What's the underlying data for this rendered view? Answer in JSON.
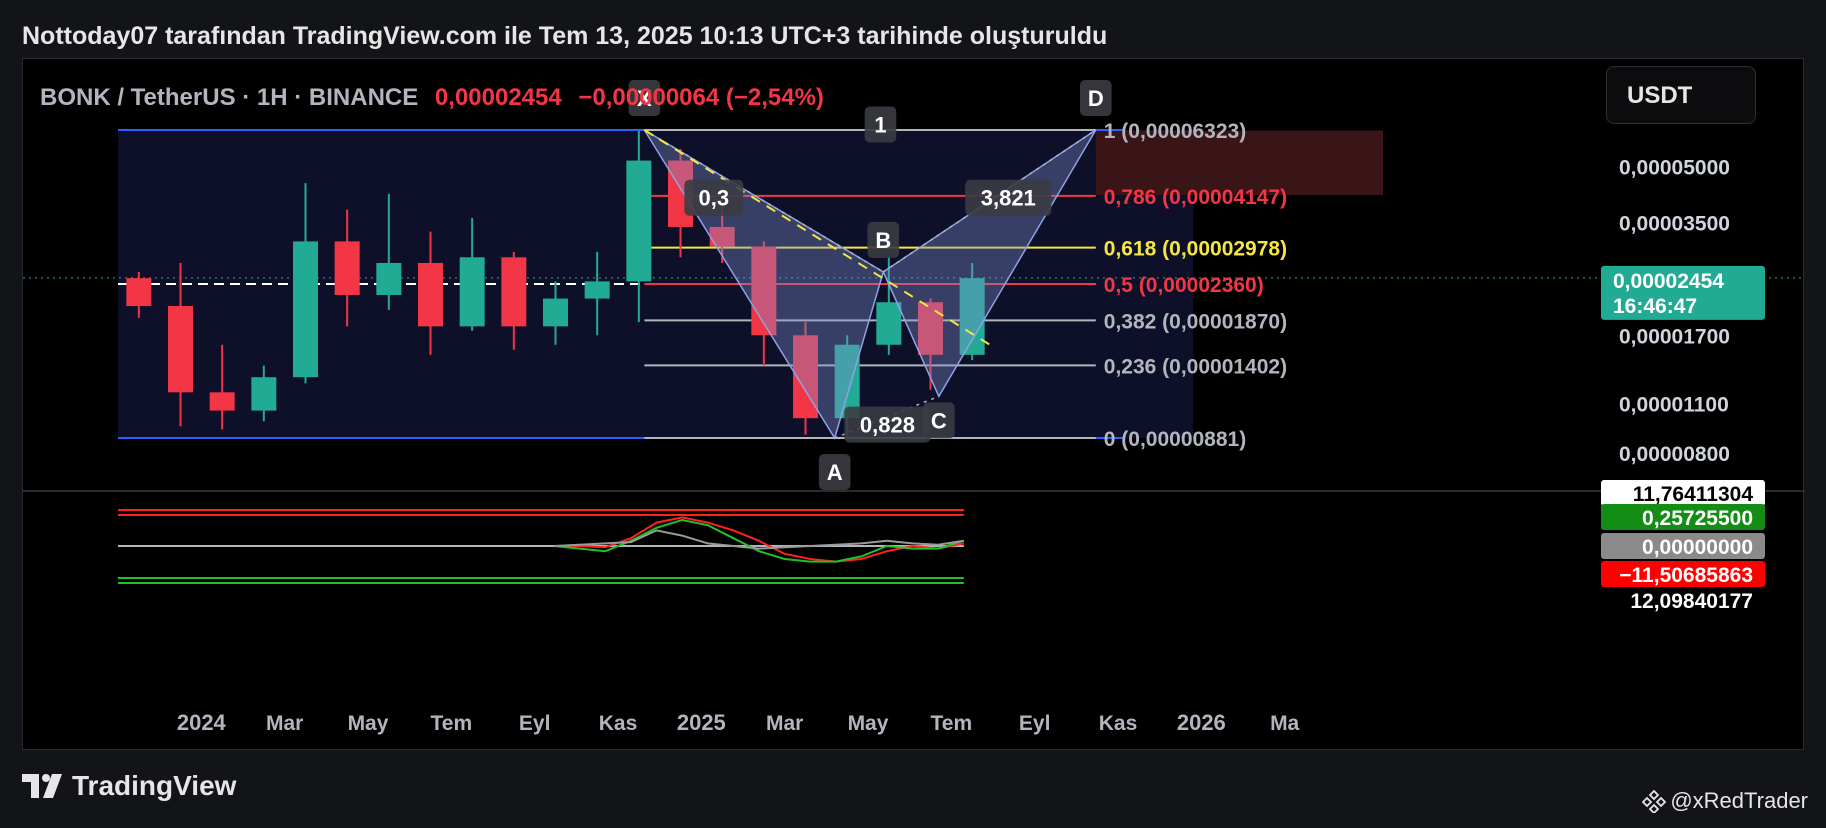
{
  "header": {
    "title": "Nottoday07 tarafından TradingView.com ile Tem 13, 2025 10:13 UTC+3 tarihinde oluşturuldu"
  },
  "symbol": {
    "name": "BONK / TetherUS · 1H · BINANCE",
    "price": "0,00002454",
    "change": "−0,00000064 (−2,54%)"
  },
  "currency_button": "USDT",
  "footer": {
    "logo": "TradingView",
    "credit": "@xRedTrader"
  },
  "colors": {
    "up": "#22ab94",
    "down": "#f23645",
    "range_line": "#2962ff",
    "fib_yellow": "#f5e642",
    "fib_red": "#f23645",
    "fib_gray": "#b2b5be",
    "pattern_fill": "#7f8fce"
  },
  "chart_data": [
    {
      "type": "candlestick",
      "title": "BONK / TetherUS · 1H · BINANCE",
      "x_axis": {
        "ticks": [
          "2024",
          "Mar",
          "May",
          "Tem",
          "Eyl",
          "Kas",
          "2025",
          "Mar",
          "May",
          "Tem",
          "Eyl",
          "Kas",
          "2026",
          "Ma"
        ],
        "range": [
          "2023-11",
          "2026-05"
        ]
      },
      "y_axis": {
        "scale": "log",
        "ticks": [
          "0,00005000",
          "0,00003500",
          "0,00001700",
          "0,00001100",
          "0,00000800"
        ],
        "range": [
          6.4e-06,
          7e-05
        ]
      },
      "last_price": {
        "value": "0,00002454",
        "countdown": "16:46:47"
      },
      "candles_monthly": [
        {
          "date": "2023-11",
          "o": 2.45e-05,
          "h": 2.55e-05,
          "l": 1.9e-05,
          "c": 2.05e-05
        },
        {
          "date": "2023-12",
          "o": 2.05e-05,
          "h": 2.7e-05,
          "l": 9.5e-06,
          "c": 1.18e-05
        },
        {
          "date": "2024-01",
          "o": 1.18e-05,
          "h": 1.6e-05,
          "l": 9.3e-06,
          "c": 1.05e-05
        },
        {
          "date": "2024-02",
          "o": 1.05e-05,
          "h": 1.4e-05,
          "l": 9.8e-06,
          "c": 1.3e-05
        },
        {
          "date": "2024-03",
          "o": 1.3e-05,
          "h": 4.5e-05,
          "l": 1.25e-05,
          "c": 3.1e-05
        },
        {
          "date": "2024-04",
          "o": 3.1e-05,
          "h": 3.8e-05,
          "l": 1.8e-05,
          "c": 2.2e-05
        },
        {
          "date": "2024-05",
          "o": 2.2e-05,
          "h": 4.2e-05,
          "l": 2e-05,
          "c": 2.7e-05
        },
        {
          "date": "2024-06",
          "o": 2.7e-05,
          "h": 3.3e-05,
          "l": 1.5e-05,
          "c": 1.8e-05
        },
        {
          "date": "2024-07",
          "o": 1.8e-05,
          "h": 3.6e-05,
          "l": 1.75e-05,
          "c": 2.8e-05
        },
        {
          "date": "2024-08",
          "o": 2.8e-05,
          "h": 2.9e-05,
          "l": 1.55e-05,
          "c": 1.8e-05
        },
        {
          "date": "2024-09",
          "o": 1.8e-05,
          "h": 2.4e-05,
          "l": 1.6e-05,
          "c": 2.15e-05
        },
        {
          "date": "2024-10",
          "o": 2.15e-05,
          "h": 2.9e-05,
          "l": 1.7e-05,
          "c": 2.4e-05
        },
        {
          "date": "2024-11",
          "o": 2.4e-05,
          "h": 6.3e-05,
          "l": 1.85e-05,
          "c": 5.2e-05
        },
        {
          "date": "2024-12",
          "o": 5.2e-05,
          "h": 5.6e-05,
          "l": 2.8e-05,
          "c": 3.4e-05
        },
        {
          "date": "2025-01",
          "o": 3.4e-05,
          "h": 4.4e-05,
          "l": 2.7e-05,
          "c": 3e-05
        },
        {
          "date": "2025-02",
          "o": 3e-05,
          "h": 3.1e-05,
          "l": 1.4e-05,
          "c": 1.7e-05
        },
        {
          "date": "2025-03",
          "o": 1.7e-05,
          "h": 1.85e-05,
          "l": 9e-06,
          "c": 1e-05
        },
        {
          "date": "2025-04",
          "o": 1e-05,
          "h": 1.7e-05,
          "l": 8.8e-06,
          "c": 1.6e-05
        },
        {
          "date": "2025-05",
          "o": 1.6e-05,
          "h": 2.8e-05,
          "l": 1.5e-05,
          "c": 2.1e-05
        },
        {
          "date": "2025-06",
          "o": 2.1e-05,
          "h": 2.15e-05,
          "l": 1.2e-05,
          "c": 1.5e-05
        },
        {
          "date": "2025-07",
          "o": 1.5e-05,
          "h": 2.7e-05,
          "l": 1.45e-05,
          "c": 2.45e-05
        }
      ],
      "horizontal_lines": [
        {
          "value": 6.323e-05,
          "style": "range"
        },
        {
          "value": 8.81e-06,
          "style": "range"
        },
        {
          "value": 2.36e-05,
          "style": "dashed-white"
        }
      ],
      "fibonacci": [
        {
          "label": "1 (0,00006323)",
          "value": 6.323e-05,
          "color": "gray"
        },
        {
          "label": "0,786 (0,00004147)",
          "value": 4.147e-05,
          "color": "red"
        },
        {
          "label": "0,618 (0,00002978)",
          "value": 2.978e-05,
          "color": "yellow"
        },
        {
          "label": "0,5 (0,00002360)",
          "value": 2.36e-05,
          "color": "red"
        },
        {
          "label": "0,382 (0,00001870)",
          "value": 1.87e-05,
          "color": "gray"
        },
        {
          "label": "0,236 (0,00001402)",
          "value": 1.402e-05,
          "color": "gray"
        },
        {
          "label": "0 (0,00000881)",
          "value": 8.81e-06,
          "color": "gray"
        }
      ],
      "harmonic_pattern": {
        "points": [
          {
            "label": "X",
            "date": "2024-11-20",
            "value": 6.323e-05
          },
          {
            "label": "A",
            "date": "2025-04-07",
            "value": 8.81e-06
          },
          {
            "label": "B",
            "date": "2025-05-12",
            "value": 2.55e-05
          },
          {
            "label": "C",
            "date": "2025-06-22",
            "value": 1.15e-05
          },
          {
            "label": "D",
            "date": "2025-10-15",
            "value": 6.323e-05
          }
        ],
        "ratios": [
          {
            "label": "0,3",
            "date": "2025-01-10",
            "value": 4.1e-05
          },
          {
            "label": "1",
            "date": "2025-05-10",
            "value": 6.55e-05
          },
          {
            "label": "3,821",
            "date": "2025-08-12",
            "value": 4.1e-05
          },
          {
            "label": "0,828",
            "date": "2025-05-15",
            "value": 9.6e-06
          }
        ]
      }
    },
    {
      "type": "line",
      "title": "",
      "y_labels": [
        "11,76411304",
        "0,25725500",
        "0,00000000",
        "−11,50685863",
        "12,09840177"
      ],
      "series": [
        {
          "color": "red",
          "values": [
            0,
            0,
            -0.5,
            3,
            9,
            11,
            9,
            6,
            2,
            -3,
            -5,
            -6,
            -5,
            -2,
            0,
            -1,
            1
          ]
        },
        {
          "color": "green",
          "values": [
            0,
            -1,
            -2,
            2,
            7,
            10,
            8,
            3,
            -2,
            -5,
            -6,
            -6,
            -4,
            0,
            -1,
            -1,
            2
          ]
        },
        {
          "color": "gray",
          "values": [
            0,
            0.5,
            1,
            1.5,
            6,
            4,
            1,
            0,
            -1,
            -0.5,
            0,
            0.5,
            1,
            2,
            1,
            0.5,
            2
          ]
        }
      ]
    }
  ]
}
